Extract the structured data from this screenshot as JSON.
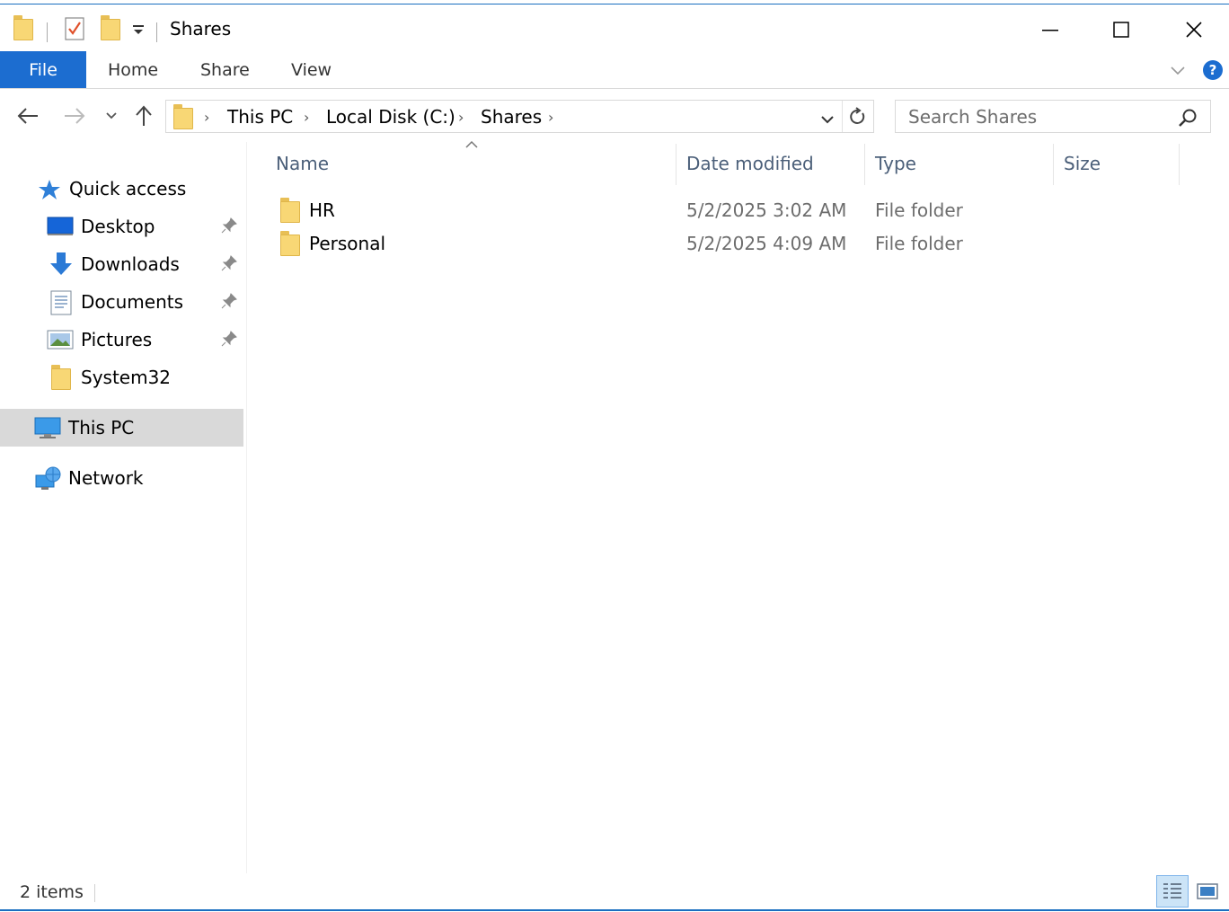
{
  "window": {
    "title": "Shares"
  },
  "ribbon": {
    "tabs": [
      {
        "label": "File"
      },
      {
        "label": "Home"
      },
      {
        "label": "Share"
      },
      {
        "label": "View"
      }
    ]
  },
  "address": {
    "crumbs": [
      "This PC",
      "Local Disk (C:)",
      "Shares"
    ]
  },
  "search": {
    "placeholder": "Search Shares"
  },
  "navpane": {
    "quick_access": "Quick access",
    "items": [
      {
        "label": "Desktop",
        "icon": "desktop-icon",
        "pinned": true
      },
      {
        "label": "Downloads",
        "icon": "download-arrow-icon",
        "pinned": true
      },
      {
        "label": "Documents",
        "icon": "documents-icon",
        "pinned": true
      },
      {
        "label": "Pictures",
        "icon": "pictures-icon",
        "pinned": true
      },
      {
        "label": "System32",
        "icon": "folder-icon",
        "pinned": false
      }
    ],
    "this_pc": "This PC",
    "network": "Network"
  },
  "columns": {
    "name": "Name",
    "date": "Date modified",
    "type": "Type",
    "size": "Size"
  },
  "files": [
    {
      "name": "HR",
      "date": "5/2/2025 3:02 AM",
      "type": "File folder"
    },
    {
      "name": "Personal",
      "date": "5/2/2025 4:09 AM",
      "type": "File folder"
    }
  ],
  "status": {
    "count": "2 items"
  },
  "colors": {
    "accent": "#1c6dd0",
    "folder": "#f8d775",
    "selected": "#d9d9d9"
  }
}
